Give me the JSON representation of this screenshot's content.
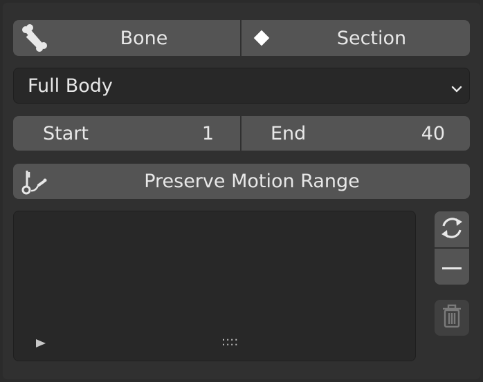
{
  "mode": {
    "bone_label": "Bone",
    "section_label": "Section"
  },
  "body_select": {
    "selected": "Full Body"
  },
  "range": {
    "start_label": "Start",
    "start_value": "1",
    "end_label": "End",
    "end_value": "40"
  },
  "preserve": {
    "label": "Preserve Motion Range"
  },
  "list": {
    "grip": "::::"
  },
  "icons": {
    "bone": "bone-icon",
    "section": "diamond-icon",
    "chevron": "chevron-down-icon",
    "preserve": "preserve-motion-icon",
    "play": "play-triangle-icon",
    "refresh": "refresh-icon",
    "remove": "minus-icon",
    "delete": "trash-icon"
  }
}
